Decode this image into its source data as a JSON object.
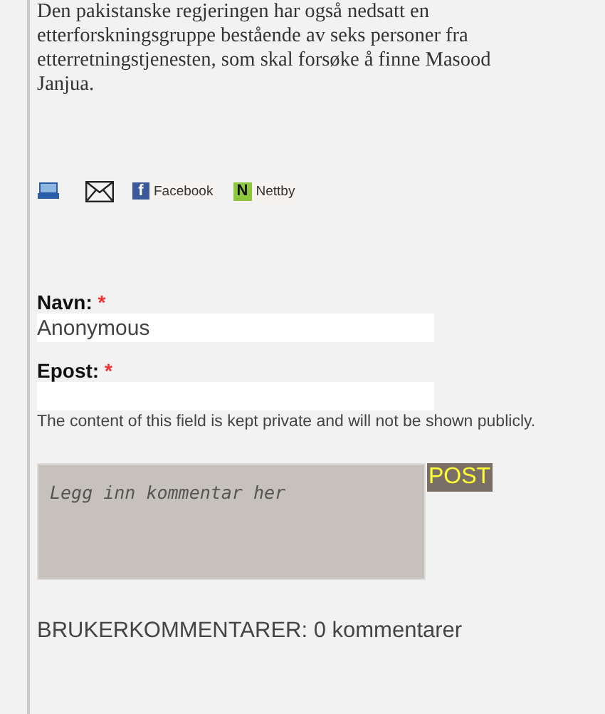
{
  "article": {
    "paragraph": "Den pakistanske regjeringen har også nedsatt en etterforskningsgruppe bestående av seks personer fra etterretningstjenesten, som skal forsøke å finne Masood Janjua."
  },
  "share": [
    {
      "kind": "print"
    },
    {
      "kind": "email"
    },
    {
      "kind": "facebook",
      "label": "Facebook",
      "glyph": "f"
    },
    {
      "kind": "nettby",
      "label": "Nettby",
      "glyph": "N"
    }
  ],
  "form": {
    "fields": [
      {
        "label": "Navn:",
        "required_mark": "*",
        "value": "Anonymous"
      },
      {
        "label": "Epost:",
        "required_mark": "*"
      }
    ],
    "note": "The content of this field is kept private and will not be shown publicly.",
    "comment_placeholder": "Legg inn kommentar her",
    "submit": "POST"
  },
  "comments": {
    "heading": "BRUKERKOMMENTARER:",
    "count": "0 kommentarer"
  }
}
